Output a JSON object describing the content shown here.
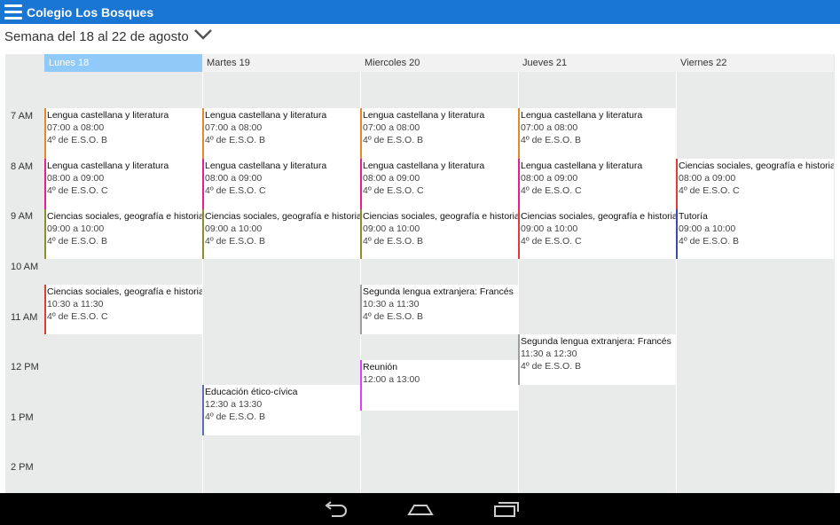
{
  "app": {
    "title": "Colegio Los Bosques"
  },
  "week": {
    "label": "Semana del 18 al 22 de agosto"
  },
  "days": [
    {
      "label": "Lunes  18",
      "selected": true
    },
    {
      "label": "Martes  19",
      "selected": false
    },
    {
      "label": "Miercoles  20",
      "selected": false
    },
    {
      "label": "Jueves  21",
      "selected": false
    },
    {
      "label": "Viernes  22",
      "selected": false
    }
  ],
  "hours": [
    "7 AM",
    "8 AM",
    "9 AM",
    "10 AM",
    "11 AM",
    "12 PM",
    "1 PM",
    "2 PM"
  ],
  "events": [
    {
      "day": 0,
      "start": "07:00",
      "end": "08:00",
      "title": "Lengua castellana y literatura",
      "time": "07:00 a 08:00",
      "group": "4º de E.S.O. B",
      "color": "#e8862a"
    },
    {
      "day": 1,
      "start": "07:00",
      "end": "08:00",
      "title": "Lengua castellana y literatura",
      "time": "07:00 a 08:00",
      "group": "4º de E.S.O. B",
      "color": "#e8862a"
    },
    {
      "day": 2,
      "start": "07:00",
      "end": "08:00",
      "title": "Lengua castellana y literatura",
      "time": "07:00 a 08:00",
      "group": "4º de E.S.O. B",
      "color": "#e8862a"
    },
    {
      "day": 3,
      "start": "07:00",
      "end": "08:00",
      "title": "Lengua castellana y literatura",
      "time": "07:00 a 08:00",
      "group": "4º de E.S.O. B",
      "color": "#e8862a"
    },
    {
      "day": 0,
      "start": "08:00",
      "end": "09:00",
      "title": "Lengua castellana y literatura",
      "time": "08:00 a 09:00",
      "group": "4º de E.S.O. C",
      "color": "#e91e8c"
    },
    {
      "day": 1,
      "start": "08:00",
      "end": "09:00",
      "title": "Lengua castellana y literatura",
      "time": "08:00 a 09:00",
      "group": "4º de E.S.O. C",
      "color": "#e91e8c"
    },
    {
      "day": 2,
      "start": "08:00",
      "end": "09:00",
      "title": "Lengua castellana y literatura",
      "time": "08:00 a 09:00",
      "group": "4º de E.S.O. C",
      "color": "#e91e8c"
    },
    {
      "day": 3,
      "start": "08:00",
      "end": "09:00",
      "title": "Lengua castellana y literatura",
      "time": "08:00 a 09:00",
      "group": "4º de E.S.O. C",
      "color": "#e91e8c"
    },
    {
      "day": 4,
      "start": "08:00",
      "end": "09:00",
      "title": "Ciencias sociales, geografía e historia",
      "time": "08:00 a 09:00",
      "group": "4º de E.S.O. C",
      "color": "#e53935"
    },
    {
      "day": 0,
      "start": "09:00",
      "end": "10:00",
      "title": "Ciencias sociales, geografía e historia",
      "time": "09:00 a 10:00",
      "group": "4º de E.S.O. B",
      "color": "#8d8d2a"
    },
    {
      "day": 1,
      "start": "09:00",
      "end": "10:00",
      "title": "Ciencias sociales, geografía e historia",
      "time": "09:00 a 10:00",
      "group": "4º de E.S.O. B",
      "color": "#8d8d2a"
    },
    {
      "day": 2,
      "start": "09:00",
      "end": "10:00",
      "title": "Ciencias sociales, geografía e historia",
      "time": "09:00 a 10:00",
      "group": "4º de E.S.O. B",
      "color": "#8d8d2a"
    },
    {
      "day": 3,
      "start": "09:00",
      "end": "10:00",
      "title": "Ciencias sociales, geografía e historia",
      "time": "09:00 a 10:00",
      "group": "4º de E.S.O. C",
      "color": "#e53935"
    },
    {
      "day": 4,
      "start": "09:00",
      "end": "10:00",
      "title": "Tutoría",
      "time": "09:00 a 10:00",
      "group": "4º de E.S.O. B",
      "color": "#3949ab"
    },
    {
      "day": 0,
      "start": "10:30",
      "end": "11:30",
      "title": "Ciencias sociales, geografía e historia",
      "time": "10:30 a 11:30",
      "group": "4º de E.S.O. C",
      "color": "#e53935"
    },
    {
      "day": 2,
      "start": "10:30",
      "end": "11:30",
      "title": "Segunda lengua extranjera: Francés",
      "time": "10:30 a 11:30",
      "group": "4º de E.S.O. B",
      "color": "#9e9e9e"
    },
    {
      "day": 3,
      "start": "11:30",
      "end": "12:30",
      "title": "Segunda lengua extranjera: Francés",
      "time": "11:30 a 12:30",
      "group": "4º de E.S.O. B",
      "color": "#9e9e9e"
    },
    {
      "day": 2,
      "start": "12:00",
      "end": "13:00",
      "title": "Reunión",
      "time": "12:00 a 13:00",
      "group": "",
      "color": "#e040fb"
    },
    {
      "day": 1,
      "start": "12:30",
      "end": "13:30",
      "title": "Educación ético-cívica",
      "time": "12:30 a 13:30",
      "group": "4º de E.S.O. B",
      "color": "#5c6bc0"
    }
  ],
  "navbar": {
    "back_icon": "back-icon",
    "home_icon": "home-icon",
    "recents_icon": "recents-icon"
  }
}
